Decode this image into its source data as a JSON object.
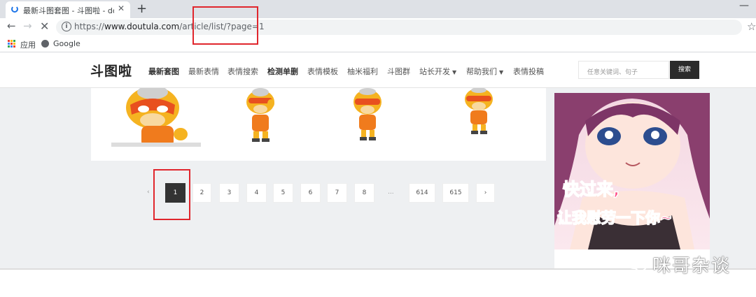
{
  "browser": {
    "tab_title": "最新斗图套图 - 斗图啦 - doutula",
    "new_tab": "+",
    "tab_close": "✕",
    "minimize": "—",
    "url_prefix": "https://",
    "url_host": "www.doutula.com",
    "url_path": "/article/list/?page=1",
    "bookmarks": [
      {
        "label": "应用"
      },
      {
        "label": "Google"
      }
    ]
  },
  "site": {
    "logo": "斗图啦",
    "nav": [
      {
        "label": "最新套图",
        "bold": true
      },
      {
        "label": "最新表情"
      },
      {
        "label": "表情搜索"
      },
      {
        "label": "检测单删",
        "bold": true
      },
      {
        "label": "表情模板"
      },
      {
        "label": "柚米福利"
      },
      {
        "label": "斗图群"
      },
      {
        "label": "站长开发",
        "dropdown": true
      },
      {
        "label": "帮助我们",
        "dropdown": true
      },
      {
        "label": "表情投稿"
      }
    ],
    "search_placeholder": "任意关键词、句子",
    "search_button": "搜索"
  },
  "pagination": {
    "prev": "‹",
    "pages": [
      "1",
      "2",
      "3",
      "4",
      "5",
      "6",
      "7",
      "8"
    ],
    "ellipsis": "...",
    "last_pages": [
      "614",
      "615"
    ],
    "next": "›",
    "current": "1"
  },
  "ad": {
    "line1": "快过来,",
    "line2": "让我慰劳一下你~"
  },
  "watermark": "咪哥杂谈",
  "colors": {
    "accent_dark": "#333333",
    "annotation_red": "#e0262d",
    "page_bg": "#eef0f2"
  }
}
